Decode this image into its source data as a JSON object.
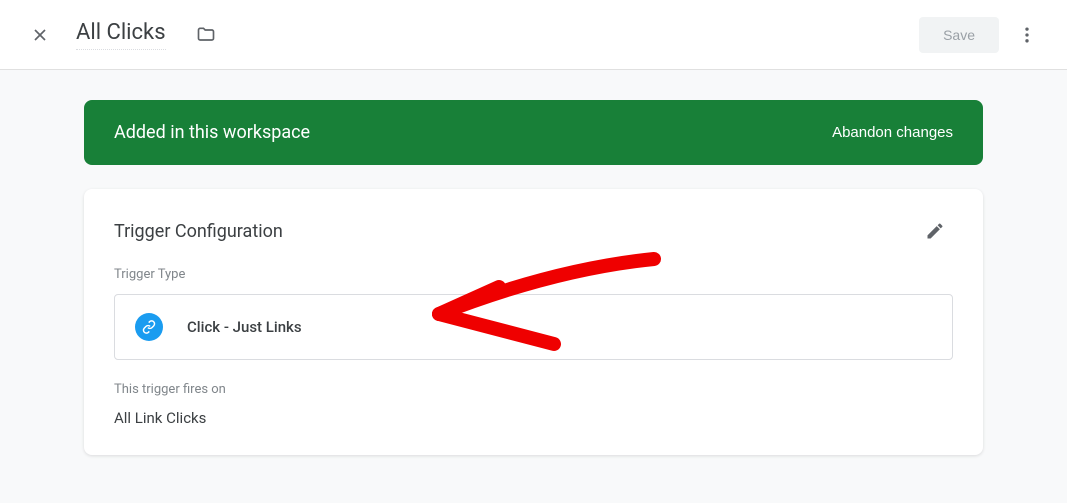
{
  "header": {
    "title": "All Clicks",
    "save_label": "Save"
  },
  "banner": {
    "text": "Added in this workspace",
    "abandon_label": "Abandon changes"
  },
  "card": {
    "title": "Trigger Configuration",
    "trigger_type_label": "Trigger Type",
    "trigger_type_value": "Click - Just Links",
    "fires_on_label": "This trigger fires on",
    "fires_on_value": "All Link Clicks"
  }
}
